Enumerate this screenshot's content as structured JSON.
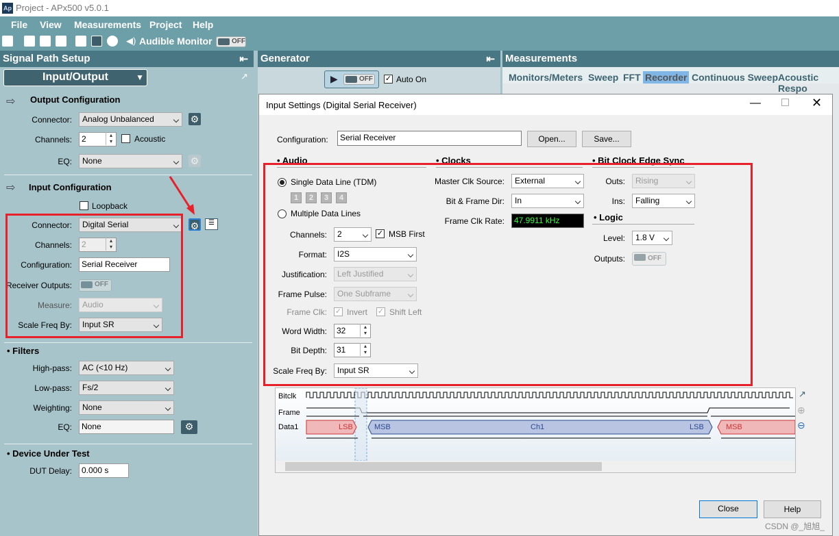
{
  "window": {
    "title": "Project - APx500 v5.0.1",
    "logo": "Ap"
  },
  "menu": [
    "File",
    "View",
    "Measurements",
    "Project",
    "Help"
  ],
  "toolbar": {
    "audible_monitor": "Audible Monitor",
    "toggle": "OFF",
    "icons": [
      "new-file-icon",
      "open-icon",
      "save-icon",
      "settings-icon",
      "swap-icon",
      "waveform-icon",
      "clock-icon",
      "speaker-icon"
    ]
  },
  "signal_path": {
    "title": "Signal Path Setup",
    "selector": "Input/Output",
    "output": {
      "title": "Output Configuration",
      "connector_label": "Connector:",
      "connector": "Analog Unbalanced",
      "channels_label": "Channels:",
      "channels": "2",
      "acoustic": "Acoustic",
      "acoustic_checked": false,
      "eq_label": "EQ:",
      "eq": "None"
    },
    "input": {
      "title": "Input Configuration",
      "loopback": "Loopback",
      "loopback_checked": false,
      "connector_label": "Connector:",
      "connector": "Digital Serial",
      "channels_label": "Channels:",
      "channels": "2",
      "config_label": "Configuration:",
      "config": "Serial Receiver",
      "receiver_outputs_label": "Receiver Outputs:",
      "receiver_outputs": "OFF",
      "measure_label": "Measure:",
      "measure": "Audio",
      "scale_label": "Scale Freq By:",
      "scale": "Input SR"
    },
    "filters": {
      "title": "Filters",
      "highpass_label": "High-pass:",
      "highpass": "AC (<10 Hz)",
      "lowpass_label": "Low-pass:",
      "lowpass": "Fs/2",
      "weighting_label": "Weighting:",
      "weighting": "None",
      "eq_label": "EQ:",
      "eq": "None"
    },
    "dut": {
      "title": "Device Under Test",
      "delay_label": "DUT Delay:",
      "delay": "0.000 s"
    }
  },
  "generator": {
    "title": "Generator",
    "toggle": "OFF",
    "auto_on": "Auto On",
    "auto_on_checked": true
  },
  "measurements": {
    "title": "Measurements",
    "tabs": [
      "Monitors/Meters",
      "Sweep",
      "FFT",
      "Recorder",
      "Continuous Sweep",
      "Acoustic Respo"
    ],
    "active_tab": "Recorder"
  },
  "dialog": {
    "title": "Input Settings (Digital Serial Receiver)",
    "config_label": "Configuration:",
    "config": "Serial Receiver",
    "open": "Open...",
    "save": "Save...",
    "audio": {
      "title": "Audio",
      "single": "Single Data Line (TDM)",
      "single_selected": true,
      "lines": [
        "1",
        "2",
        "3",
        "4"
      ],
      "multiple": "Multiple Data Lines",
      "channels_label": "Channels:",
      "channels": "2",
      "msb_first": "MSB First",
      "msb_first_checked": true,
      "format_label": "Format:",
      "format": "I2S",
      "just_label": "Justification:",
      "just": "Left Justified",
      "pulse_label": "Frame Pulse:",
      "pulse": "One Subframe",
      "frameclk_label": "Frame Clk:",
      "invert": "Invert",
      "shift_left": "Shift Left",
      "word_width_label": "Word Width:",
      "word_width": "32",
      "bit_depth_label": "Bit Depth:",
      "bit_depth": "31",
      "scale_label": "Scale Freq By:",
      "scale": "Input SR"
    },
    "clocks": {
      "title": "Clocks",
      "master_label": "Master Clk Source:",
      "master": "External",
      "dir_label": "Bit & Frame Dir:",
      "dir": "In",
      "rate_label": "Frame Clk Rate:",
      "rate": "47.9911 kHz",
      "rate_color": "#33ff33"
    },
    "edge": {
      "title": "Bit Clock Edge Sync",
      "outs_label": "Outs:",
      "outs": "Rising",
      "ins_label": "Ins:",
      "ins": "Falling"
    },
    "logic": {
      "title": "Logic",
      "level_label": "Level:",
      "level": "1.8 V",
      "outputs_label": "Outputs:",
      "outputs": "OFF"
    },
    "timing": {
      "bitclk": "Bitclk",
      "frame": "Frame",
      "data": "Data1",
      "lsb": "LSB",
      "msb": "MSB",
      "ch": "Ch1"
    },
    "close": "Close",
    "help": "Help"
  },
  "watermark": "CSDN @_旭旭_",
  "colors": {
    "highlight": "#e8202a",
    "panel_header": "#4a7784",
    "menu": "#6d9fa9"
  }
}
